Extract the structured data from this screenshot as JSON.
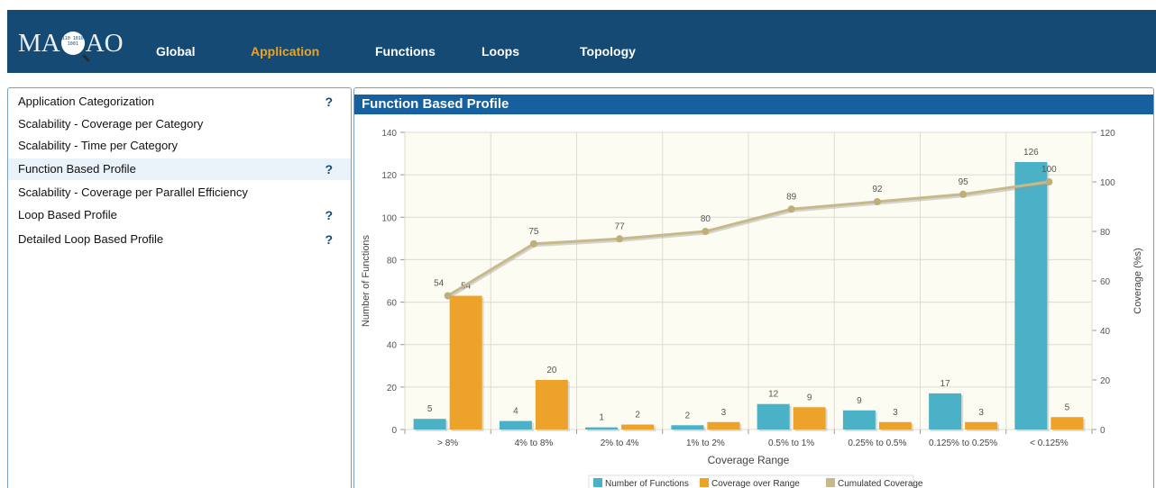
{
  "header": {
    "logo_text_left": "MA",
    "logo_text_right": "AO",
    "logo_globe_text": "110 1010 1001",
    "nav": [
      {
        "label": "Global",
        "active": false
      },
      {
        "label": "Application",
        "active": true
      },
      {
        "label": "Functions",
        "active": false
      },
      {
        "label": "Loops",
        "active": false
      },
      {
        "label": "Topology",
        "active": false
      }
    ],
    "bg_color": "#154a74",
    "active_color": "#f0a21b"
  },
  "sidebar": {
    "items": [
      {
        "label": "Application Categorization",
        "help": "?",
        "selected": false
      },
      {
        "label": "Scalability - Coverage per Category",
        "help": "",
        "selected": false
      },
      {
        "label": "Scalability - Time per Category",
        "help": "",
        "selected": false
      },
      {
        "label": "Function Based Profile",
        "help": "?",
        "selected": true
      },
      {
        "label": "Scalability - Coverage per Parallel Efficiency",
        "help": "",
        "selected": false
      },
      {
        "label": "Loop Based Profile",
        "help": "?",
        "selected": false
      },
      {
        "label": "Detailed Loop Based Profile",
        "help": "?",
        "selected": false
      }
    ]
  },
  "panel": {
    "title": "Function Based Profile"
  },
  "chart_data": {
    "type": "bar",
    "categories": [
      "> 8%",
      "4% to 8%",
      "2% to 4%",
      "1% to 2%",
      "0.5% to 1%",
      "0.25% to 0.5%",
      "0.125% to 0.25%",
      "< 0.125%"
    ],
    "series": [
      {
        "name": "Number of Functions",
        "type": "bar",
        "axis": "left",
        "color": "#4ab1c6",
        "values": [
          5,
          4,
          1,
          2,
          12,
          9,
          17,
          126
        ]
      },
      {
        "name": "Coverage over Range",
        "type": "bar",
        "axis": "right",
        "color": "#eda32a",
        "values": [
          54,
          20,
          2,
          3,
          9,
          3,
          3,
          5
        ]
      },
      {
        "name": "Cumulated Coverage",
        "type": "line",
        "axis": "right",
        "color": "#c7b98a",
        "values": [
          54,
          75,
          77,
          80,
          89,
          92,
          95,
          100
        ]
      }
    ],
    "xlabel": "Coverage Range",
    "ylabel": "Number of Functions",
    "y2label": "Coverage (%s)",
    "ylim": [
      0,
      140
    ],
    "yticks": [
      0,
      20,
      40,
      60,
      80,
      100,
      120,
      140
    ],
    "y2lim": [
      0,
      120
    ],
    "y2ticks": [
      0,
      20,
      40,
      60,
      80,
      100,
      120
    ],
    "grid": true,
    "legend_position": "bottom-center",
    "plot_bg": "#fdfcf2"
  }
}
